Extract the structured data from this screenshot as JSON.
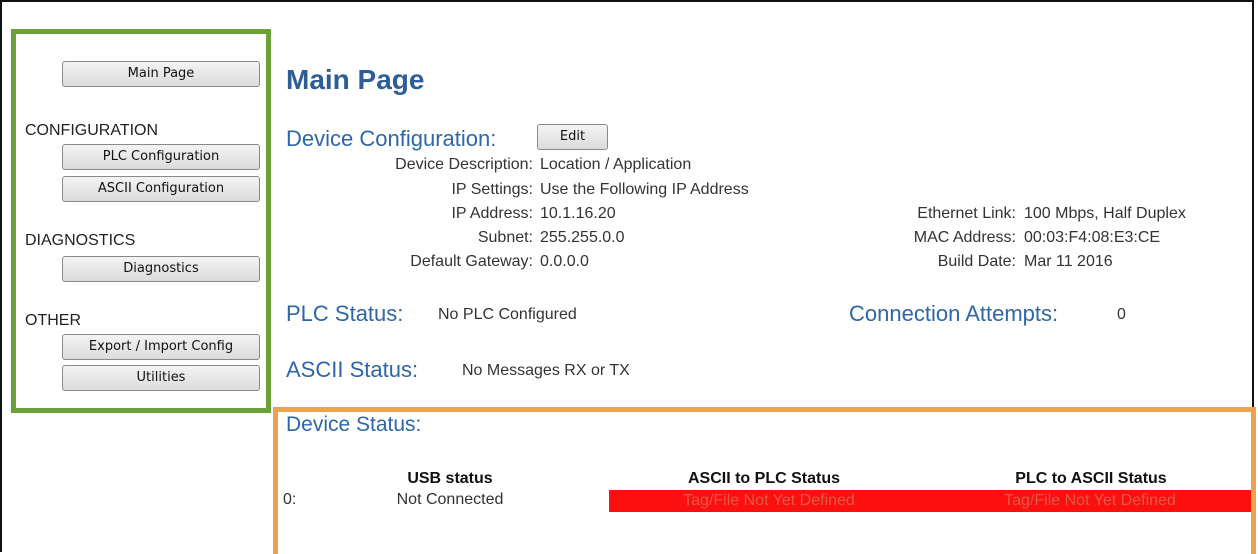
{
  "sidebar": {
    "main_page_button": "Main Page",
    "sections": [
      {
        "heading": "CONFIGURATION",
        "buttons": [
          "PLC Configuration",
          "ASCII Configuration"
        ]
      },
      {
        "heading": "DIAGNOSTICS",
        "buttons": [
          "Diagnostics"
        ]
      },
      {
        "heading": "OTHER",
        "buttons": [
          "Export / Import Config",
          "Utilities"
        ]
      }
    ]
  },
  "main": {
    "title": "Main Page",
    "device_config": {
      "heading": "Device Configuration:",
      "edit_button": "Edit",
      "fields": [
        {
          "label": "Device Description:",
          "value": "Location / Application"
        },
        {
          "label": "IP Settings:",
          "value": "Use the Following IP Address"
        },
        {
          "label": "IP Address:",
          "value": "10.1.16.20"
        },
        {
          "label": "Subnet:",
          "value": "255.255.0.0"
        },
        {
          "label": "Default Gateway:",
          "value": "0.0.0.0"
        }
      ],
      "right_fields": [
        {
          "label": "Ethernet Link:",
          "value": "100 Mbps, Half Duplex"
        },
        {
          "label": "MAC Address:",
          "value": "00:03:F4:08:E3:CE"
        },
        {
          "label": "Build Date:",
          "value": "Mar 11 2016"
        }
      ]
    },
    "plc_status": {
      "heading": "PLC Status:",
      "value": "No PLC Configured"
    },
    "connection_attempts": {
      "heading": "Connection Attempts:",
      "value": "0"
    },
    "ascii_status": {
      "heading": "ASCII Status:",
      "value": "No Messages RX or TX"
    },
    "device_status": {
      "heading": "Device Status:",
      "columns": [
        "USB status",
        "ASCII to PLC Status",
        "PLC to ASCII Status"
      ],
      "rows": [
        {
          "index": "0:",
          "usb": "Not Connected",
          "ascii_to_plc": "Tag/File Not Yet Defined",
          "plc_to_ascii": "Tag/File Not Yet Defined"
        }
      ],
      "error_color": "#fb0f0f"
    }
  }
}
